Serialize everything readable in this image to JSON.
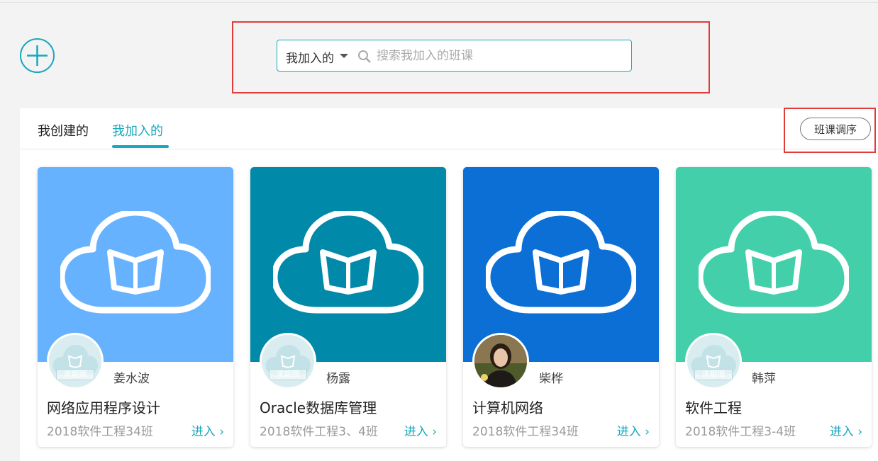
{
  "search": {
    "scope_label": "我加入的",
    "placeholder": "搜索我加入的班课"
  },
  "tabs": [
    {
      "label": "我创建的",
      "active": false
    },
    {
      "label": "我加入的",
      "active": true
    }
  ],
  "sort_button_label": "班课调序",
  "colors": {
    "accent": "#17a8bd",
    "highlight_box": "#e03c3c"
  },
  "courses": [
    {
      "cover_color": "#66b2ff",
      "teacher": "姜水波",
      "name": "网络应用程序设计",
      "class": "2018软件工程34班",
      "enter_label": "进入",
      "avatar_stamp": "求靓照"
    },
    {
      "cover_color": "#0089a8",
      "teacher": "杨露",
      "name": "Oracle数据库管理",
      "class": "2018软件工程3、4班",
      "enter_label": "进入",
      "avatar_stamp": "求靓照"
    },
    {
      "cover_color": "#0b6fd6",
      "teacher": "柴桦",
      "name": "计算机网络",
      "class": "2018软件工程34班",
      "enter_label": "进入",
      "avatar_stamp": ""
    },
    {
      "cover_color": "#42cfaa",
      "teacher": "韩萍",
      "name": "软件工程",
      "class": "2018软件工程3-4班",
      "enter_label": "进入",
      "avatar_stamp": "求靓照"
    }
  ]
}
